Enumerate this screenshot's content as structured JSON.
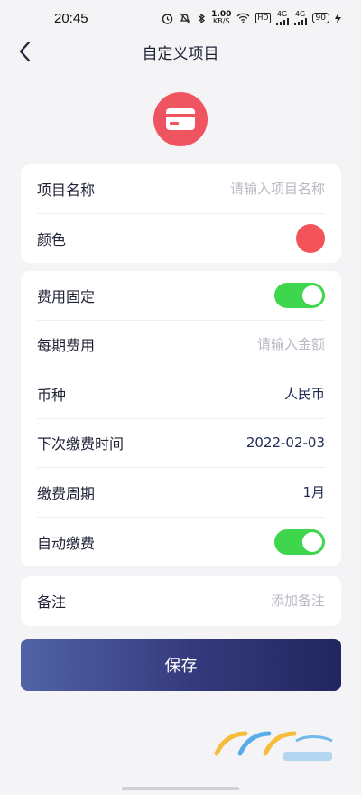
{
  "status_bar": {
    "time": "20:45",
    "network_speed_value": "1.00",
    "network_speed_unit": "KB/S",
    "hd_badge": "HD",
    "signal_1": "4G",
    "signal_2": "4G",
    "battery": "90"
  },
  "header": {
    "title": "自定义项目",
    "back_icon": "chevron-left-icon"
  },
  "category": {
    "icon": "card-icon",
    "color": "#ef5560"
  },
  "basic_info": {
    "name_label": "项目名称",
    "name_placeholder": "请输入项目名称",
    "color_label": "颜色",
    "color_value": "#f3545c"
  },
  "fee_settings": {
    "fixed_fee_label": "费用固定",
    "fixed_fee_enabled": true,
    "period_fee_label": "每期费用",
    "period_fee_placeholder": "请输入金额",
    "currency_label": "币种",
    "currency_value": "人民币",
    "next_payment_label": "下次缴费时间",
    "next_payment_value": "2022-02-03",
    "cycle_label": "缴费周期",
    "cycle_value": "1月",
    "auto_pay_label": "自动缴费",
    "auto_pay_enabled": true
  },
  "notes": {
    "label": "备注",
    "placeholder": "添加备注"
  },
  "actions": {
    "save_label": "保存"
  },
  "colors": {
    "accent_red": "#ef5560",
    "toggle_green": "#3dd64c",
    "button_gradient_start": "#5163a6",
    "button_gradient_end": "#22265e"
  }
}
